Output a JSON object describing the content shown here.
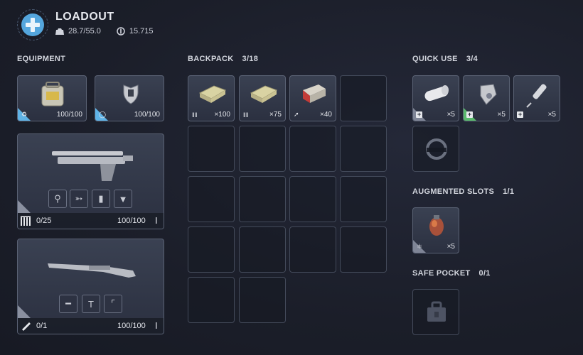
{
  "header": {
    "title": "LOADOUT",
    "weight": "28.7/55.0",
    "currency": "15.715"
  },
  "equipment": {
    "label": "EQUIPMENT",
    "armor": [
      {
        "icon": "backpack-icon",
        "durability": "100/100"
      },
      {
        "icon": "shield-icon",
        "durability": "100/100"
      }
    ],
    "weapons": [
      {
        "name_icon": "pistol-icon",
        "ammo": "0/25",
        "durability": "100/100",
        "attachments": [
          "grip-attachment-icon",
          "stock-attachment-icon",
          "magazine-attachment-icon",
          "muzzle-attachment-icon"
        ]
      },
      {
        "name_icon": "rifle-icon",
        "ammo": "0/1",
        "durability": "100/100",
        "attachments": [
          "barrel-attachment-icon",
          "tech-mod-icon",
          "grip-attachment-icon"
        ]
      }
    ]
  },
  "backpack": {
    "label": "BACKPACK",
    "count": "3/18",
    "items": [
      {
        "icon": "light-ammo-icon",
        "qty": "×100"
      },
      {
        "icon": "light-ammo-icon",
        "qty": "×75"
      },
      {
        "icon": "energy-cell-icon",
        "qty": "×40"
      }
    ]
  },
  "quick_use": {
    "label": "QUICK USE",
    "count": "3/4",
    "items": [
      {
        "icon": "bandage-icon",
        "qty": "×5"
      },
      {
        "icon": "grenade-icon",
        "qty": "×5"
      },
      {
        "icon": "syringe-icon",
        "qty": "×5"
      }
    ]
  },
  "augmented": {
    "label": "AUGMENTED SLOTS",
    "count": "1/1",
    "items": [
      {
        "icon": "augment-icon",
        "qty": "×5"
      }
    ]
  },
  "safe_pocket": {
    "label": "SAFE POCKET",
    "count": "0/1"
  },
  "colors": {
    "accent_blue": "#5fb3e6",
    "accent_green": "#59b96c",
    "background": "#1c1f2b"
  }
}
